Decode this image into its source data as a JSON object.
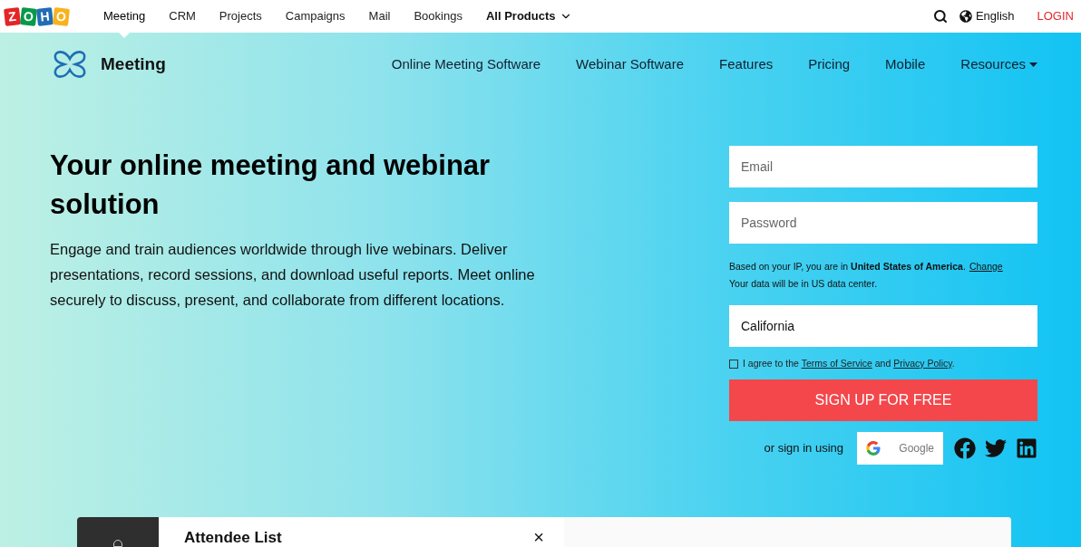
{
  "top_bar": {
    "logo_letters": [
      {
        "letter": "Z",
        "color": "#e42527"
      },
      {
        "letter": "O",
        "color": "#089949"
      },
      {
        "letter": "H",
        "color": "#226db4"
      },
      {
        "letter": "O",
        "color": "#f9b21d"
      }
    ],
    "products": [
      {
        "label": "Meeting",
        "selected": true
      },
      {
        "label": "CRM",
        "selected": false
      },
      {
        "label": "Projects",
        "selected": false
      },
      {
        "label": "Campaigns",
        "selected": false
      },
      {
        "label": "Mail",
        "selected": false
      },
      {
        "label": "Bookings",
        "selected": false
      }
    ],
    "all_products": "All Products",
    "language": "English",
    "login": "LOGIN"
  },
  "product_nav": {
    "brand": "Meeting",
    "items": [
      {
        "label": "Online Meeting Software",
        "has_dropdown": false
      },
      {
        "label": "Webinar Software",
        "has_dropdown": false
      },
      {
        "label": "Features",
        "has_dropdown": false
      },
      {
        "label": "Pricing",
        "has_dropdown": false
      },
      {
        "label": "Mobile",
        "has_dropdown": false
      },
      {
        "label": "Resources",
        "has_dropdown": true
      }
    ]
  },
  "hero": {
    "title": "Your online meeting and webinar solution",
    "description": "Engage and train audiences worldwide through live webinars. Deliver presentations, record sessions, and download useful reports. Meet online securely to discuss, present, and collaborate from different locations."
  },
  "signup": {
    "email_placeholder": "Email",
    "password_placeholder": "Password",
    "ip_notice": "Based on your IP, you are in **United States of America**.",
    "change_link": "Change",
    "data_center_note": "Your data will be in US data center.",
    "region_value": "California",
    "agree": {
      "checked": false,
      "prefix": "I agree to the",
      "terms": "Terms of Service",
      "middle": "and",
      "privacy": "Privacy Policy",
      "suffix": "."
    },
    "submit": "SIGN UP FOR FREE",
    "social_label": "or sign in using",
    "google": "Google"
  },
  "preview": {
    "title": "Attendee List",
    "close": "×"
  }
}
